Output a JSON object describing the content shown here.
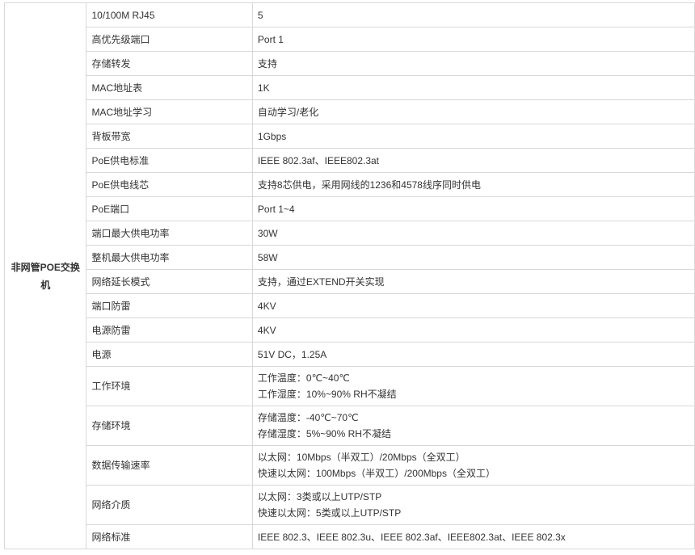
{
  "category": "非网管POE交换机",
  "rows": [
    {
      "label": "10/100M RJ45",
      "value": [
        "5"
      ]
    },
    {
      "label": "高优先级端口",
      "value": [
        "Port 1"
      ]
    },
    {
      "label": "存储转发",
      "value": [
        "支持"
      ]
    },
    {
      "label": "MAC地址表",
      "value": [
        "1K"
      ]
    },
    {
      "label": "MAC地址学习",
      "value": [
        "自动学习/老化"
      ]
    },
    {
      "label": "背板带宽",
      "value": [
        "1Gbps"
      ]
    },
    {
      "label": "PoE供电标准",
      "value": [
        "IEEE 802.3af、IEEE802.3at"
      ]
    },
    {
      "label": "PoE供电线芯",
      "value": [
        "支持8芯供电，采用网线的1236和4578线序同时供电"
      ]
    },
    {
      "label": "PoE端口",
      "value": [
        "Port 1~4"
      ]
    },
    {
      "label": "端口最大供电功率",
      "value": [
        "30W"
      ]
    },
    {
      "label": "整机最大供电功率",
      "value": [
        "58W"
      ]
    },
    {
      "label": "网络延长模式",
      "value": [
        "支持，通过EXTEND开关实现"
      ]
    },
    {
      "label": "端口防雷",
      "value": [
        "4KV"
      ]
    },
    {
      "label": "电源防雷",
      "value": [
        "4KV"
      ]
    },
    {
      "label": "电源",
      "value": [
        "51V DC，1.25A"
      ]
    },
    {
      "label": "工作环境",
      "value": [
        "工作温度：0℃~40℃",
        "工作湿度：10%~90% RH不凝结"
      ]
    },
    {
      "label": "存储环境",
      "value": [
        "存储温度：-40℃~70℃",
        "存储湿度：5%~90% RH不凝结"
      ]
    },
    {
      "label": "数据传输速率",
      "value": [
        "以太网：10Mbps（半双工）/20Mbps（全双工）",
        "快速以太网：100Mbps（半双工）/200Mbps（全双工）"
      ]
    },
    {
      "label": "网络介质",
      "value": [
        "以太网：3类或以上UTP/STP",
        "快速以太网：5类或以上UTP/STP"
      ]
    },
    {
      "label": "网络标准",
      "value": [
        "IEEE 802.3、IEEE 802.3u、IEEE 802.3af、IEEE802.3at、IEEE 802.3x"
      ]
    }
  ]
}
